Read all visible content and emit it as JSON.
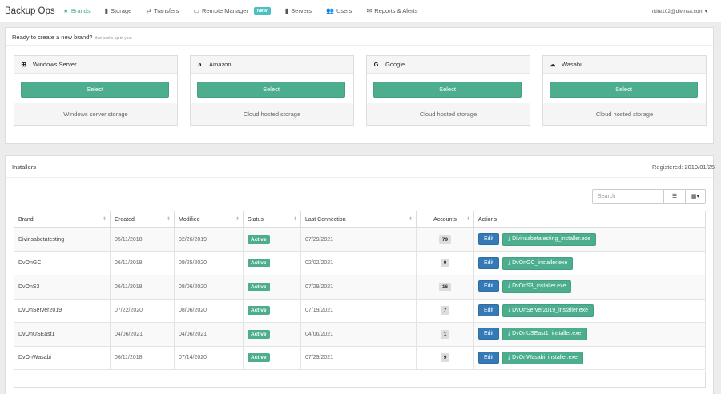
{
  "nav": {
    "title": "Backup Ops",
    "items": [
      {
        "label": "Brands",
        "icon": "★"
      },
      {
        "label": "Storage",
        "icon": "▮"
      },
      {
        "label": "Transfers",
        "icon": "⇄"
      },
      {
        "label": "Remote Manager",
        "icon": "▭",
        "badge": "NEW"
      },
      {
        "label": "Servers",
        "icon": "▮"
      },
      {
        "label": "Users",
        "icon": "👥"
      },
      {
        "label": "Reports & Alerts",
        "icon": "✉"
      }
    ],
    "user": "rkite102@divinsa.com ▾"
  },
  "brand_panel": {
    "heading": "Ready to create a new brand?",
    "subheading": "that backs up to your",
    "cards": [
      {
        "name": "Windows Server",
        "icon": "⊞",
        "button": "Select",
        "footer": "Windows server storage"
      },
      {
        "name": "Amazon",
        "icon": "a",
        "button": "Select",
        "footer": "Cloud hosted storage"
      },
      {
        "name": "Google",
        "icon": "G",
        "button": "Select",
        "footer": "Cloud hosted storage"
      },
      {
        "name": "Wasabi",
        "icon": "☁",
        "button": "Select",
        "footer": "Cloud hosted storage"
      }
    ]
  },
  "installers": {
    "heading": "Installers",
    "registered": "Registered: 2019/01/25",
    "search_placeholder": "Search",
    "columns": [
      "Brand",
      "Created",
      "Modified",
      "Status",
      "Last Connection",
      "Accounts",
      "Actions"
    ],
    "rows": [
      {
        "brand": "Divinsabetatesting",
        "created": "05/11/2018",
        "modified": "02/26/2019",
        "status": "Active",
        "last": "07/29/2021",
        "accounts": "79",
        "edit": "Edit",
        "file": "Divinsabetatesting_installer.exe"
      },
      {
        "brand": "DvOnGC",
        "created": "06/11/2018",
        "modified": "09/25/2020",
        "status": "Active",
        "last": "02/02/2021",
        "accounts": "9",
        "edit": "Edit",
        "file": "DvOnGC_installer.exe"
      },
      {
        "brand": "DvOnS3",
        "created": "06/11/2018",
        "modified": "08/06/2020",
        "status": "Active",
        "last": "07/29/2021",
        "accounts": "16",
        "edit": "Edit",
        "file": "DvOnS3_installer.exe"
      },
      {
        "brand": "DvOnServer2019",
        "created": "07/22/2020",
        "modified": "08/06/2020",
        "status": "Active",
        "last": "07/19/2021",
        "accounts": "7",
        "edit": "Edit",
        "file": "DvOnServer2019_installer.exe"
      },
      {
        "brand": "DvOnUSEast1",
        "created": "04/06/2021",
        "modified": "04/06/2021",
        "status": "Active",
        "last": "04/06/2021",
        "accounts": "1",
        "edit": "Edit",
        "file": "DvOnUSEast1_installer.exe"
      },
      {
        "brand": "DvOnWasabi",
        "created": "06/11/2018",
        "modified": "07/14/2020",
        "status": "Active",
        "last": "07/29/2021",
        "accounts": "9",
        "edit": "Edit",
        "file": "DvOnWasabi_installer.exe"
      }
    ]
  },
  "colors": {
    "accent": "#4cae8f",
    "primary": "#337ab7",
    "new_badge": "#4cc0c0"
  }
}
